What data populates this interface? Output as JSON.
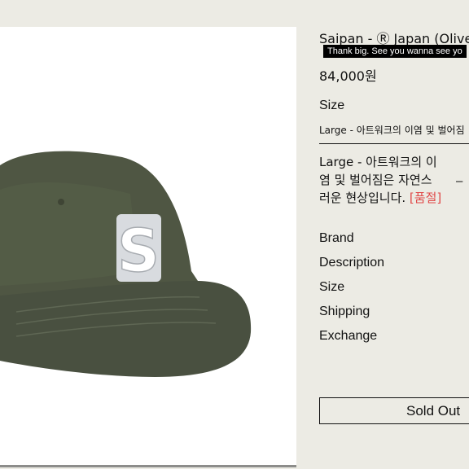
{
  "product": {
    "title": "Saipan - Ⓡ Japan (Oliver",
    "tooltip": "Thank big. See you wanna see yo",
    "price": "84,000원",
    "letter": "S"
  },
  "size": {
    "label": "Size",
    "selected": "Large - 아트워크의 이염 및 벌어짐"
  },
  "selected_option": {
    "line1": "Large - 아트워크의 이",
    "line2": "염 및 벌어짐은 자연스",
    "line3": "러운 현상입니다.",
    "soldout_tag": "[품절]",
    "remove": "–"
  },
  "info": [
    "Brand",
    "Description",
    "Size",
    "Shipping",
    "Exchange"
  ],
  "buttons": {
    "soldout": "Sold Out"
  },
  "colors": {
    "background": "#ecebe4",
    "cap": "#4f5643",
    "accent_red": "#e04848"
  }
}
